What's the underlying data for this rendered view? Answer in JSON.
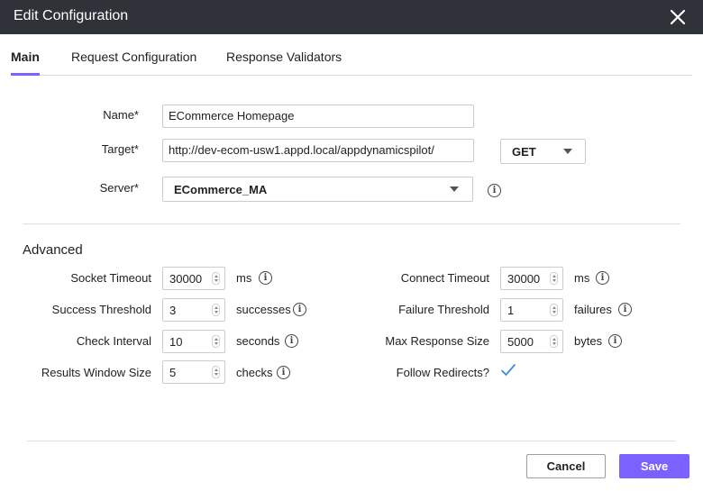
{
  "window": {
    "title": "Edit Configuration",
    "close_icon": "close-icon"
  },
  "tabs": [
    {
      "label": "Main",
      "active": true
    },
    {
      "label": "Request Configuration",
      "active": false
    },
    {
      "label": "Response Validators",
      "active": false
    }
  ],
  "main": {
    "name": {
      "label": "Name*",
      "value": "ECommerce Homepage"
    },
    "target": {
      "label": "Target*",
      "value": "http://dev-ecom-usw1.appd.local/appdynamicspilot/"
    },
    "method": {
      "value": "GET"
    },
    "server": {
      "label": "Server*",
      "value": "ECommerce_MA"
    }
  },
  "advanced": {
    "title": "Advanced",
    "socket_timeout": {
      "label": "Socket Timeout",
      "value": "30000",
      "unit": "ms"
    },
    "success_threshold": {
      "label": "Success Threshold",
      "value": "3",
      "unit": "successes"
    },
    "check_interval": {
      "label": "Check Interval",
      "value": "10",
      "unit": "seconds"
    },
    "results_window_size": {
      "label": "Results Window Size",
      "value": "5",
      "unit": "checks"
    },
    "connect_timeout": {
      "label": "Connect Timeout",
      "value": "30000",
      "unit": "ms"
    },
    "failure_threshold": {
      "label": "Failure Threshold",
      "value": "1",
      "unit": "failures"
    },
    "max_response_size": {
      "label": "Max Response Size",
      "value": "5000",
      "unit": "bytes"
    },
    "follow_redirects": {
      "label": "Follow Redirects?",
      "checked": true
    }
  },
  "footer": {
    "cancel_label": "Cancel",
    "save_label": "Save"
  },
  "colors": {
    "accent": "#7b61ff",
    "titlebar": "#2f3238"
  }
}
